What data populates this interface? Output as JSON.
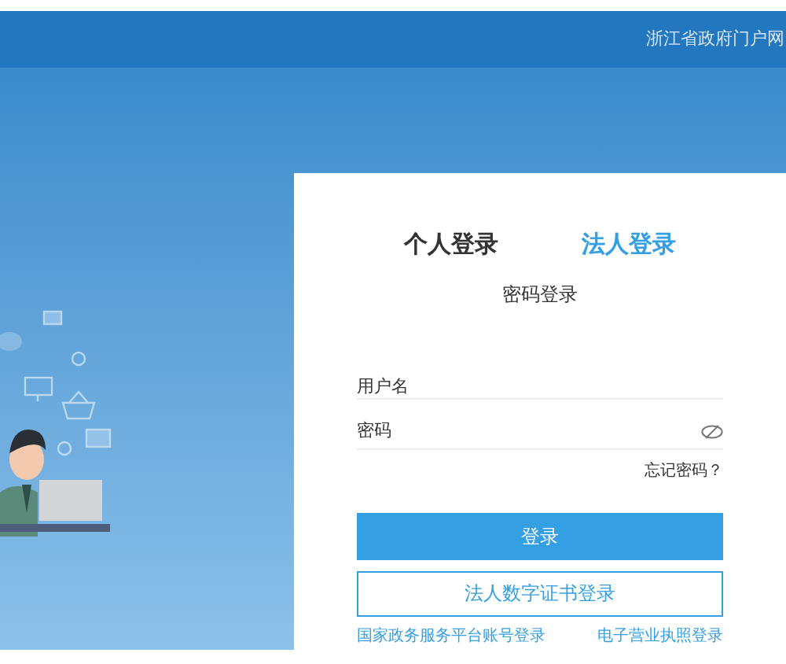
{
  "header": {
    "link": "浙江省政府门户网"
  },
  "tabs": [
    {
      "label": "个人登录",
      "selected": false
    },
    {
      "label": "法人登录",
      "selected": true
    }
  ],
  "subtitle": "密码登录",
  "username": {
    "placeholder": "用户名"
  },
  "password": {
    "placeholder": "密码"
  },
  "forgot": "忘记密码？",
  "login_button": "登录",
  "cert_button": "法人数字证书登录",
  "links": [
    "国家政务服务平台账号登录",
    "电子营业执照登录"
  ]
}
